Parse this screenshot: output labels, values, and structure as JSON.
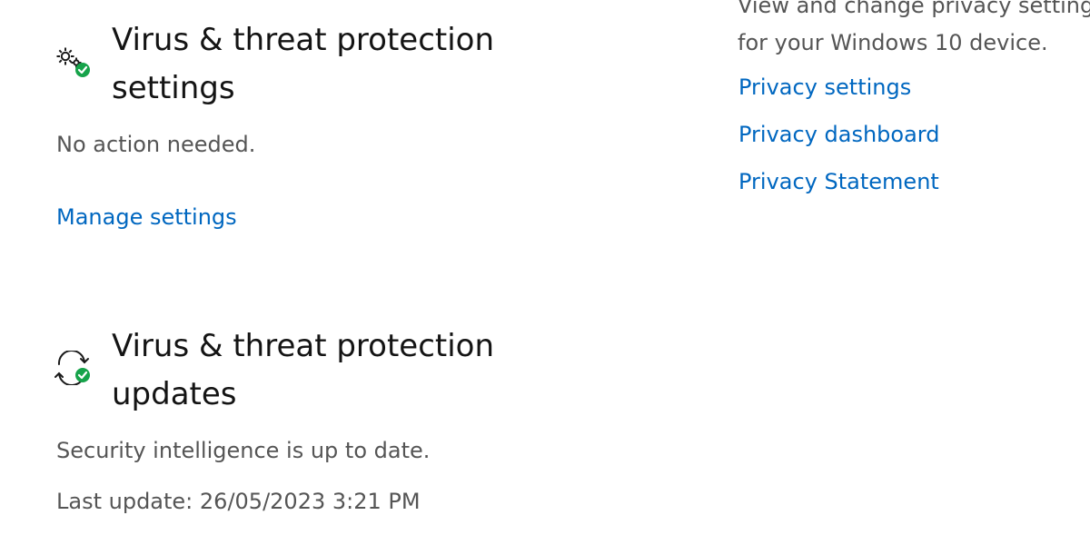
{
  "settings_section": {
    "title": "Virus & threat protection settings",
    "status": "No action needed.",
    "link": "Manage settings",
    "icon": "settings-gears-check-icon"
  },
  "updates_section": {
    "title": "Virus & threat protection updates",
    "status": "Security intelligence is up to date.",
    "last_update": "Last update: 26/05/2023 3:21 PM",
    "icon": "sync-check-icon"
  },
  "privacy_panel": {
    "description_line1": "View and change privacy settings",
    "description_line2": "for your Windows 10 device.",
    "links": [
      "Privacy settings",
      "Privacy dashboard",
      "Privacy Statement"
    ]
  },
  "colors": {
    "link": "#0067c0",
    "check_badge": "#16a34a",
    "secondary_text": "#555555"
  }
}
